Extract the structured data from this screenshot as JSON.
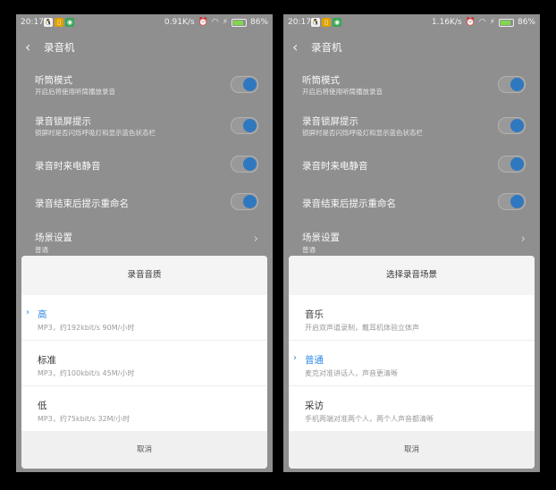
{
  "phones": [
    {
      "status": {
        "time": "20:17",
        "speed": "0.91K/s",
        "battery": "86%"
      },
      "title": "录音机",
      "settings": [
        {
          "label": "听筒模式",
          "desc": "开启后将使用听筒播放录音"
        },
        {
          "label": "录音锁屏提示",
          "desc": "锁屏时是否闪烁呼吸灯和显示蓝色状态栏"
        },
        {
          "label": "录音时来电静音",
          "desc": ""
        },
        {
          "label": "录音结束后提示重命名",
          "desc": ""
        },
        {
          "label": "场景设置",
          "desc": "普通"
        }
      ],
      "sheet": {
        "title": "录音音质",
        "options": [
          {
            "label": "高",
            "desc": "MP3，约192kbit/s 90M/小时",
            "selected": true
          },
          {
            "label": "标准",
            "desc": "MP3，约100kbit/s 45M/小时",
            "selected": false
          },
          {
            "label": "低",
            "desc": "MP3，约75kbit/s 32M/小时",
            "selected": false
          }
        ],
        "cancel": "取消"
      }
    },
    {
      "status": {
        "time": "20:17",
        "speed": "1.16K/s",
        "battery": "86%"
      },
      "title": "录音机",
      "settings": [
        {
          "label": "听筒模式",
          "desc": "开启后将使用听筒播放录音"
        },
        {
          "label": "录音锁屏提示",
          "desc": "锁屏时是否闪烁呼吸灯和显示蓝色状态栏"
        },
        {
          "label": "录音时来电静音",
          "desc": ""
        },
        {
          "label": "录音结束后提示重命名",
          "desc": ""
        },
        {
          "label": "场景设置",
          "desc": "普通"
        }
      ],
      "sheet": {
        "title": "选择录音场景",
        "options": [
          {
            "label": "音乐",
            "desc": "开启双声道录制，戴耳机体验立体声",
            "selected": false
          },
          {
            "label": "普通",
            "desc": "麦克对准讲话人，声音更清晰",
            "selected": true
          },
          {
            "label": "采访",
            "desc": "手机两端对准两个人，两个人声音都清晰",
            "selected": false
          }
        ],
        "cancel": "取消"
      }
    }
  ],
  "colors": {
    "accent": "#2d8ae5",
    "toggle_knob": "#2f78c0",
    "dim_background": "#8f8f8f"
  }
}
